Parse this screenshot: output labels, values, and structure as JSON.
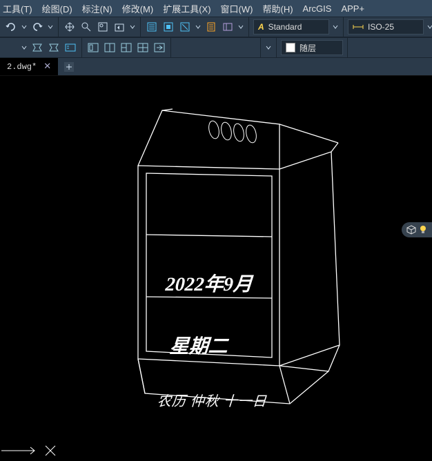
{
  "menu": {
    "tools": "工具(T)",
    "draw": "绘图(D)",
    "annotate": "标注(N)",
    "modify": "修改(M)",
    "ext": "扩展工具(X)",
    "window": "窗口(W)",
    "help": "帮助(H)",
    "arcgis": "ArcGIS",
    "appplus": "APP+"
  },
  "styles": {
    "text": "Standard",
    "dim": "ISO-25",
    "layer": "随层"
  },
  "tab": {
    "active": "2.dwg*"
  },
  "calendar": {
    "line1": "2022年9月",
    "line2": "星期二",
    "line3": "农历 仲秋 十一日"
  }
}
